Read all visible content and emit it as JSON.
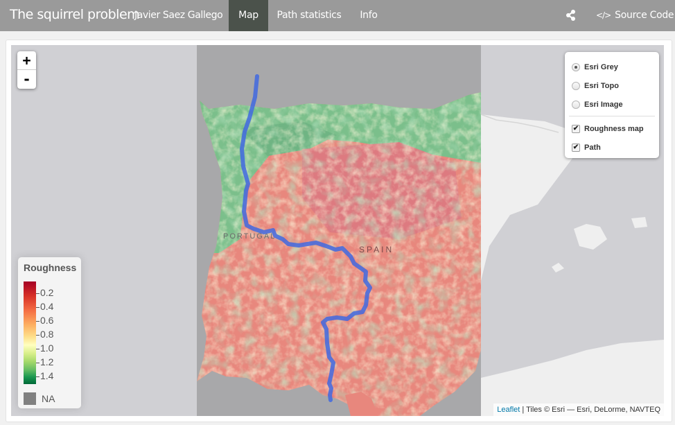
{
  "navbar": {
    "title": "The squirrel problem",
    "author": "Javier Saez Gallego",
    "tabs": [
      {
        "label": "Map",
        "active": true
      },
      {
        "label": "Path statistics",
        "active": false
      },
      {
        "label": "Info",
        "active": false
      }
    ],
    "share_icon": "share-icon",
    "source_icon_glyph": "</>",
    "source_label": "Source Code"
  },
  "map": {
    "zoom_in": "+",
    "zoom_out": "-",
    "labels": {
      "portugal": "PORTUGAL",
      "spain": "SPAIN"
    },
    "layers": {
      "base": [
        {
          "label": "Esri Grey",
          "selected": true
        },
        {
          "label": "Esri Topo",
          "selected": false
        },
        {
          "label": "Esri Image",
          "selected": false
        }
      ],
      "overlays": [
        {
          "label": "Roughness map",
          "checked": true
        },
        {
          "label": "Path",
          "checked": true
        }
      ]
    },
    "legend": {
      "title": "Roughness",
      "ticks": [
        "0.2",
        "0.4",
        "0.6",
        "0.8",
        "1.0",
        "1.2",
        "1.4"
      ],
      "na_label": "NA",
      "colors": {
        "low": "#a50026",
        "mid": "#ffffbf",
        "high": "#006837",
        "na": "#808080"
      }
    },
    "attribution": {
      "link": "Leaflet",
      "text": " | Tiles © Esri — Esri, DeLorme, NAVTEQ"
    },
    "path_color": "#4169e1"
  }
}
